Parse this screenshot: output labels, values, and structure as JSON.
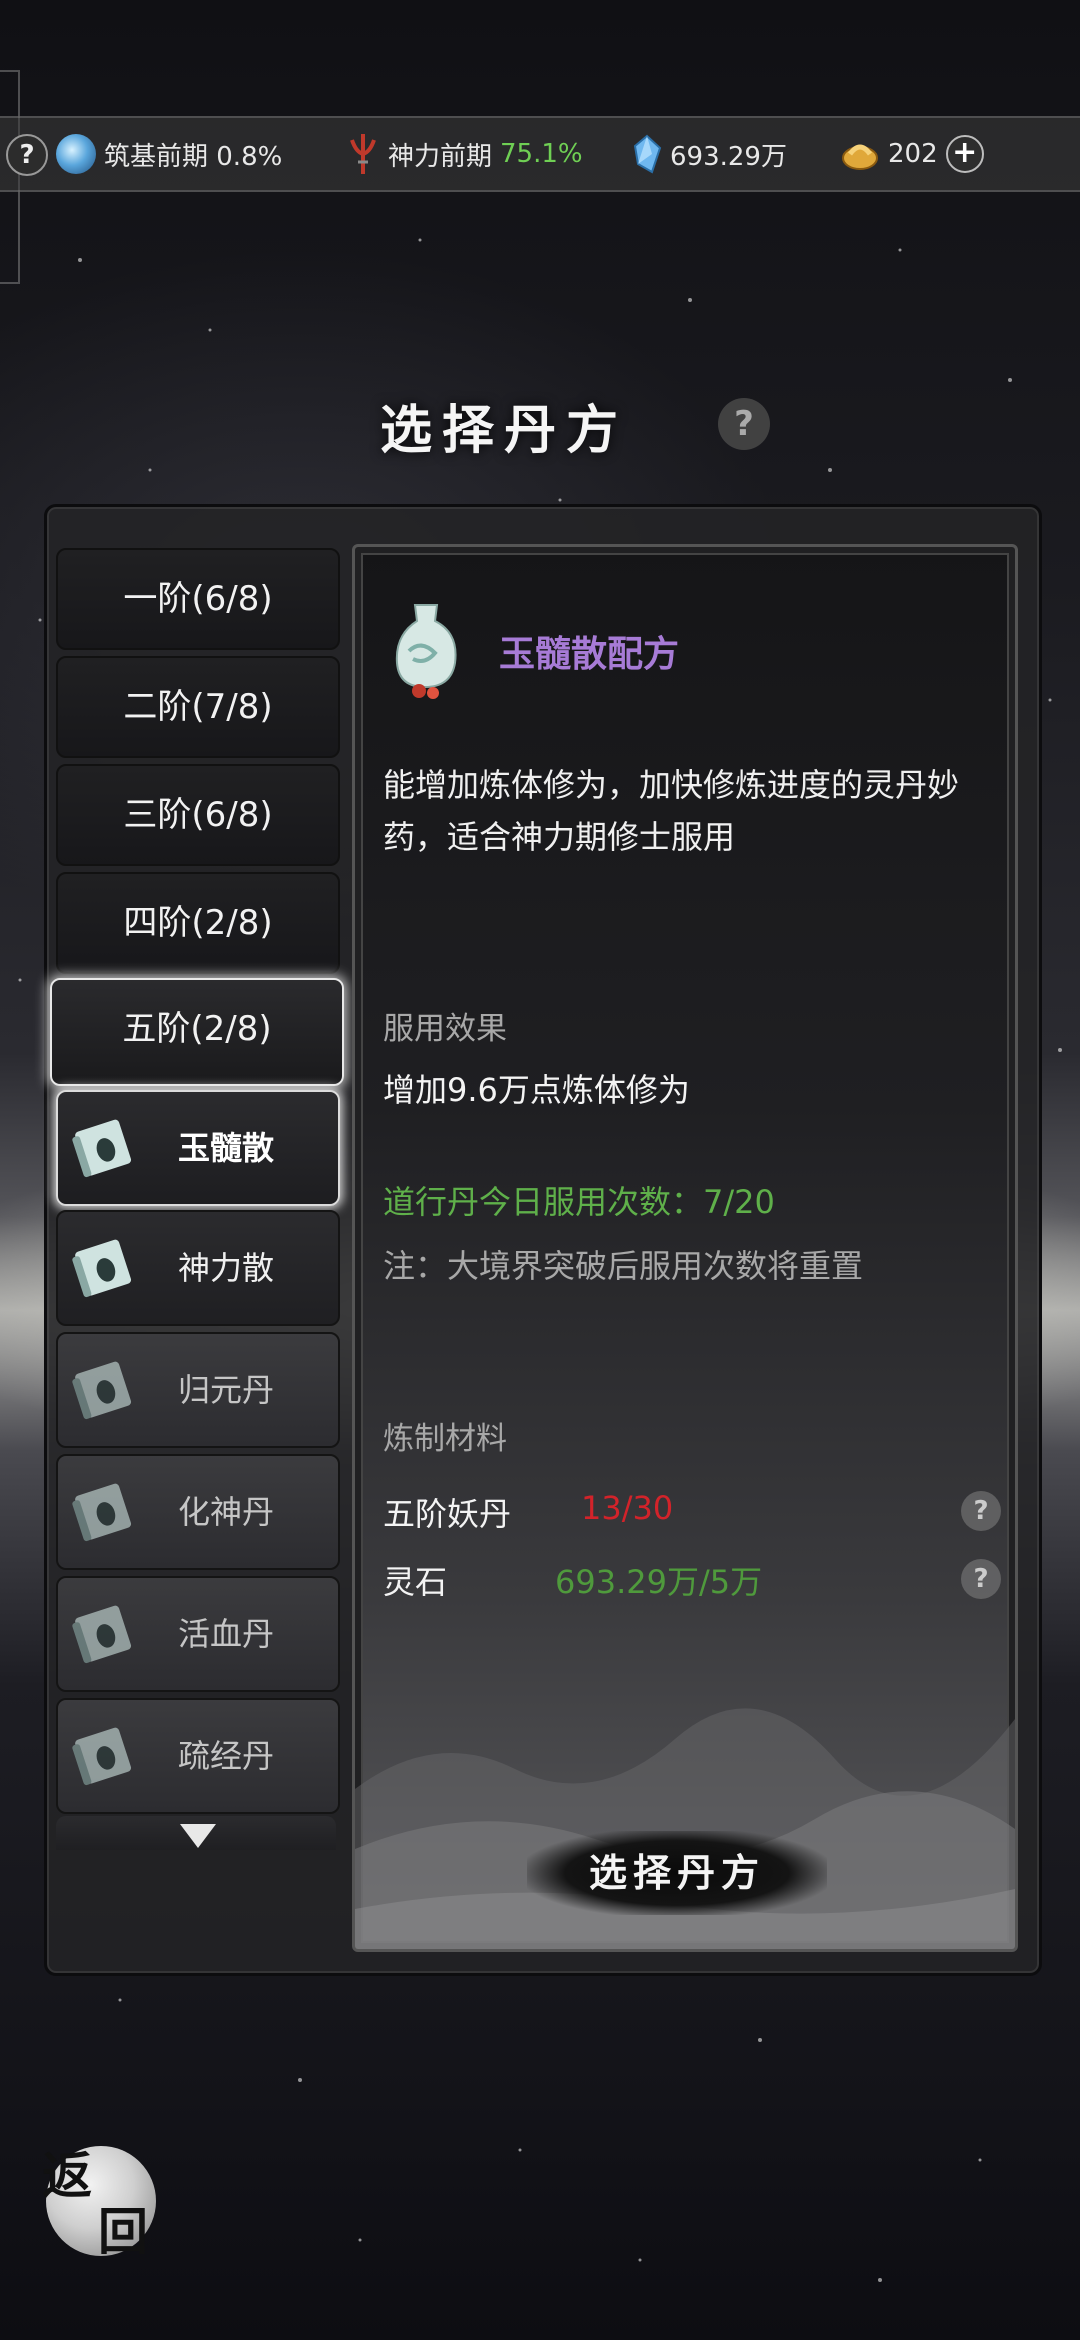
{
  "topbar": {
    "help": "?",
    "cultivation": "筑基前期 0.8%",
    "power_label": "神力前期",
    "power_value": "75.1%",
    "spirit_stones": "693.29万",
    "gold": "202",
    "plus": "+"
  },
  "title": "选择丹方",
  "title_help": "?",
  "tiers": [
    {
      "label": "一阶(6/8)"
    },
    {
      "label": "二阶(7/8)"
    },
    {
      "label": "三阶(6/8)"
    },
    {
      "label": "四阶(2/8)"
    },
    {
      "label": "五阶(2/8)"
    }
  ],
  "recipes": [
    {
      "name": "玉髓散"
    },
    {
      "name": "神力散"
    },
    {
      "name": "归元丹"
    },
    {
      "name": "化神丹"
    },
    {
      "name": "活血丹"
    },
    {
      "name": "疏经丹"
    }
  ],
  "detail": {
    "recipe_title": "玉髓散配方",
    "description": "能增加炼体修为，加快修炼进度的灵丹妙药，适合神力期修士服用",
    "effect_label": "服用效果",
    "effect_text": "增加9.6万点炼体修为",
    "daily_use": "道行丹今日服用次数：7/20",
    "note": "注：大境界突破后服用次数将重置",
    "materials_label": "炼制材料",
    "materials": [
      {
        "name": "五阶妖丹",
        "amount": "13/30",
        "color": "#d2232a"
      },
      {
        "name": "灵石",
        "amount": "693.29万/5万",
        "color": "#4f9a3c"
      }
    ],
    "material_help": "?",
    "select_button": "选择丹方"
  },
  "back": {
    "line1": "返",
    "line2": "回"
  },
  "colors": {
    "purple_title": "#a77bd6",
    "green": "#5fb04a",
    "red": "#d2232a"
  }
}
